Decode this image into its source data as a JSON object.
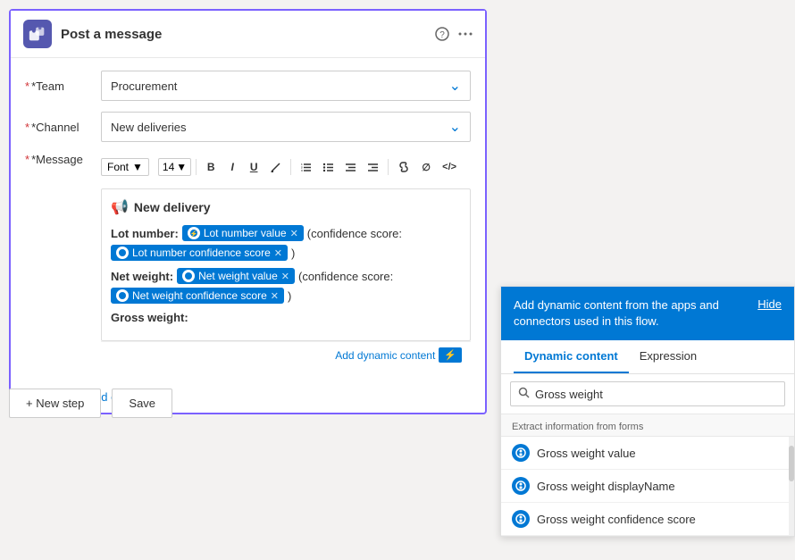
{
  "header": {
    "title": "Post a message",
    "help_icon": "?",
    "more_icon": "..."
  },
  "form": {
    "team_label": "*Team",
    "team_value": "Procurement",
    "channel_label": "*Channel",
    "channel_value": "New deliveries",
    "message_label": "*Message",
    "font_label": "Font",
    "font_size": "14",
    "toolbar": {
      "bold": "B",
      "italic": "I",
      "underline": "U",
      "highlight": "✏",
      "ol": "≡",
      "ul": "≡",
      "outdent": "≪",
      "indent": "≫",
      "link": "🔗",
      "clear": "∅",
      "code": "</>"
    },
    "message": {
      "heading": "New delivery",
      "lot_label": "Lot number:",
      "lot_token": "Lot number value",
      "confidence_text": "(confidence score:",
      "lot_confidence_token": "Lot number confidence score",
      "paren_close_lot": ")",
      "net_label": "Net weight:",
      "net_token": "Net weight value",
      "net_confidence_text": "(confidence score:",
      "net_confidence_token": "Net weight confidence score",
      "paren_close_net": ")",
      "gross_label": "Gross weight:"
    },
    "add_dynamic_label": "Add dynamic content",
    "show_advanced": "Show advanced options"
  },
  "buttons": {
    "new_step": "+ New step",
    "save": "Save"
  },
  "dynamic_panel": {
    "header_text": "Add dynamic content from the apps and connectors used in this flow.",
    "hide_label": "Hide",
    "tab_dynamic": "Dynamic content",
    "tab_expression": "Expression",
    "search_placeholder": "Gross weight",
    "section_label": "Extract information from forms",
    "items": [
      {
        "label": "Gross weight value"
      },
      {
        "label": "Gross weight displayName"
      },
      {
        "label": "Gross weight confidence score"
      }
    ]
  }
}
